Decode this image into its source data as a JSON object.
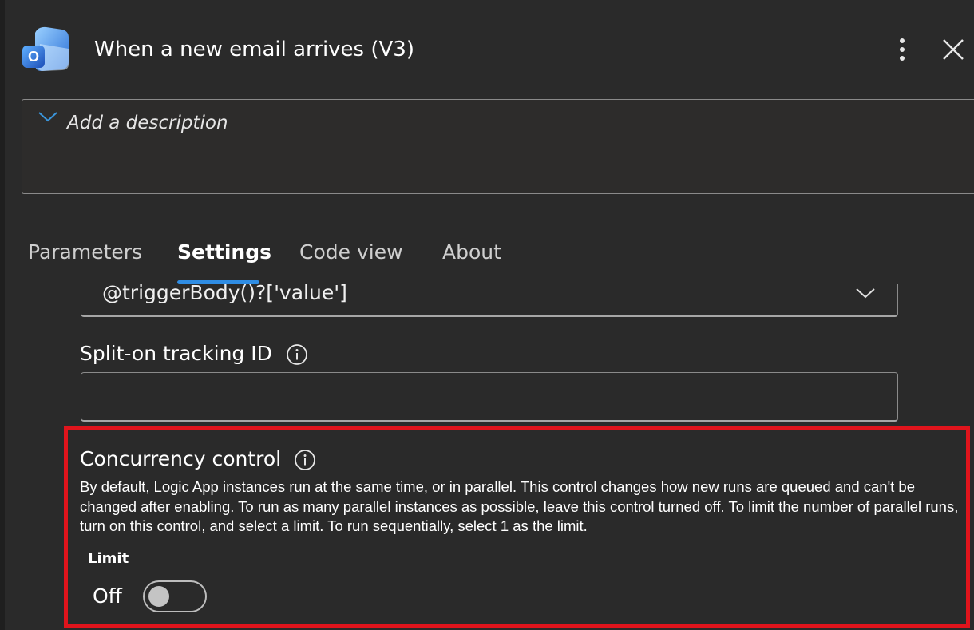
{
  "header": {
    "title": "When a new email arrives (V3)",
    "app_icon": "outlook-icon",
    "more_icon": "more-vertical-icon",
    "close_icon": "close-icon"
  },
  "description": {
    "placeholder": "Add a description",
    "chevron_icon": "chevron-down-icon"
  },
  "tabs": [
    {
      "label": "Parameters",
      "active": false
    },
    {
      "label": "Settings",
      "active": true
    },
    {
      "label": "Code view",
      "active": false
    },
    {
      "label": "About",
      "active": false
    }
  ],
  "split_on": {
    "value": "@triggerBody()?['value']",
    "chevron_icon": "chevron-down-icon"
  },
  "tracking_id": {
    "label": "Split-on tracking ID",
    "value": "",
    "info_icon": "info-icon"
  },
  "concurrency": {
    "title": "Concurrency control",
    "info_icon": "info-icon",
    "description": "By default, Logic App instances run at the same time, or in parallel. This control changes how new runs are queued and can't be changed after enabling. To run as many parallel instances as possible, leave this control turned off. To limit the number of parallel runs, turn on this control, and select a limit. To run sequentially, select 1 as the limit.",
    "limit_label": "Limit",
    "toggle_state_label": "Off",
    "toggle_on": false
  },
  "colors": {
    "background": "#2a2a2a",
    "accent": "#2f8de4",
    "highlight_border": "#e0141c"
  }
}
